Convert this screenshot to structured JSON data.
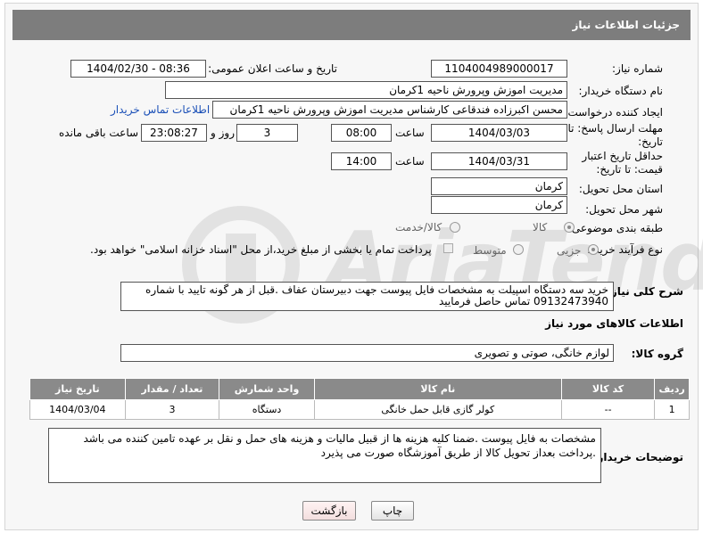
{
  "header": {
    "title": "جزئیات اطلاعات نیاز"
  },
  "labels": {
    "need_number": "شماره نیاز:",
    "announce_datetime": "تاریخ و ساعت اعلان عمومی:",
    "buyer_org": "نام دستگاه خریدار:",
    "requester": "ایجاد کننده درخواست:",
    "response_deadline": "مهلت ارسال پاسخ: تا تاریخ:",
    "price_validity": "حداقل تاریخ اعتبار قیمت: تا تاریخ:",
    "time": "ساعت",
    "day_and": "روز و",
    "remaining": "ساعت باقی مانده",
    "delivery_province": "استان محل تحویل:",
    "delivery_city": "شهر محل تحویل:",
    "subject_class": "طبقه بندی موضوعی:",
    "process_type": "نوع فرآیند خرید :",
    "general_desc": "شرح کلی نیاز:",
    "goods_info": "اطلاعات کالاهای مورد نیاز",
    "goods_group": "گروه کالا:",
    "buyer_notes": "توضیحات خریدار:"
  },
  "fields": {
    "need_number": "1104004989000017",
    "announce_datetime": "1404/02/30 - 08:36",
    "buyer_org": "مدیریت اموزش وپرورش ناحیه 1کرمان",
    "requester": "محسن اکبرزاده فندقاعی کارشناس  مدیریت اموزش وپرورش ناحیه 1کرمان",
    "buyer_contact_link": "اطلاعات تماس خریدار",
    "response_date": "1404/03/03",
    "response_time": "08:00",
    "remaining_days": "3",
    "remaining_time": "23:08:27",
    "price_date": "1404/03/31",
    "price_time": "14:00",
    "delivery_province": "کرمان",
    "delivery_city": "کرمان",
    "general_desc": "خرید سه دستگاه اسپیلت به مشخصات فایل پیوست جهت دبیرستان عفاف .قبل از هر گونه تایید با شماره 09132473940 تماس حاصل فرمایید",
    "goods_group": "لوازم خانگی، صوتی و تصویری",
    "buyer_notes": "مشخصات به فایل پیوست .ضمنا کلیه هزینه ها از قبیل مالیات و هزینه های حمل و نقل بر عهده تامین کننده می باشد .پرداخت بعداز تحویل کالا از طریق آموزشگاه صورت می پذیرد"
  },
  "subject_options": {
    "goods": "کالا",
    "goods_service": "کالا/خدمت"
  },
  "process_options": {
    "minor": "جزیی",
    "medium": "متوسط",
    "treasury_note": "پرداخت تمام یا بخشی از مبلغ خرید،از محل \"اسناد خزانه اسلامی\" خواهد بود."
  },
  "table": {
    "headers": [
      "ردیف",
      "کد کالا",
      "نام کالا",
      "واحد شمارش",
      "تعداد / مقدار",
      "تاریخ نیاز"
    ],
    "rows": [
      {
        "row": "1",
        "code": "--",
        "name": "کولر گازی قابل حمل خانگی",
        "unit": "دستگاه",
        "qty": "3",
        "date": "1404/03/04"
      }
    ]
  },
  "buttons": {
    "print": "چاپ",
    "back": "بازگشت"
  },
  "watermark": {
    "brand": "AriaTender.neT"
  }
}
